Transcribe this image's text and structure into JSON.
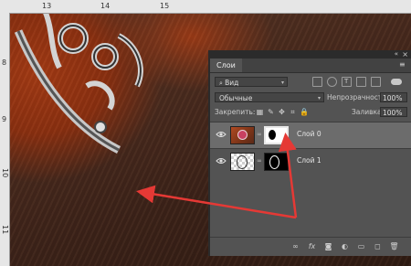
{
  "ruler": {
    "top_marks": [
      "13",
      "14",
      "15"
    ],
    "left_marks": [
      "8",
      "9",
      "10",
      "11"
    ]
  },
  "panel": {
    "tab_title": "Слои",
    "filter_label": "Вид",
    "blend_mode": "Обычные",
    "opacity_label": "Непрозрачность:",
    "opacity_value": "100%",
    "lock_label": "Закрепить:",
    "fill_label": "Заливка:",
    "fill_value": "100%",
    "layers": [
      {
        "name": "Слой 0",
        "selected": true
      },
      {
        "name": "Слой 1",
        "selected": false
      }
    ],
    "bottom_icons": [
      "link-icon",
      "fx-icon",
      "mask-icon",
      "adjustment-icon",
      "group-icon",
      "new-layer-icon",
      "trash-icon"
    ]
  },
  "colors": {
    "arrow": "#e53935",
    "panel_bg": "#535353",
    "selected_layer": "#6c6c6c"
  }
}
